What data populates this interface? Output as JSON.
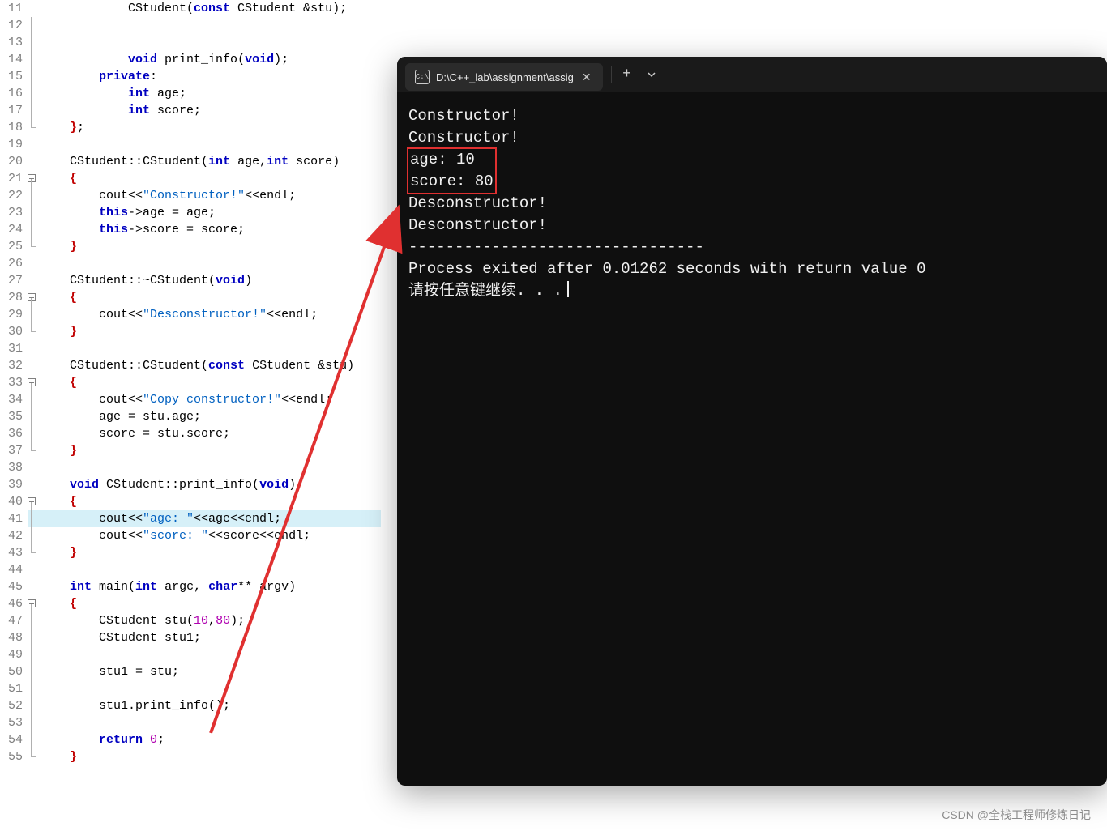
{
  "editor": {
    "lines": [
      {
        "n": 11,
        "fold": " ",
        "html": "        CStudent(<span class='kw'>const</span> CStudent &amp;stu);"
      },
      {
        "n": 12,
        "fold": "|",
        "html": ""
      },
      {
        "n": 13,
        "fold": "|",
        "html": ""
      },
      {
        "n": 14,
        "fold": "|",
        "html": "        <span class='kw'>void</span> print_info(<span class='kw'>void</span>);"
      },
      {
        "n": 15,
        "fold": "|",
        "html": "    <span class='kw'>private</span>:"
      },
      {
        "n": 16,
        "fold": "|",
        "html": "        <span class='kw'>int</span> age;"
      },
      {
        "n": 17,
        "fold": "|",
        "html": "        <span class='kw'>int</span> score;"
      },
      {
        "n": 18,
        "fold": "L",
        "html": "<span class='br'>}</span>;"
      },
      {
        "n": 19,
        "fold": " ",
        "html": ""
      },
      {
        "n": 20,
        "fold": " ",
        "html": "CStudent::CStudent(<span class='kw'>int</span> age,<span class='kw'>int</span> score)"
      },
      {
        "n": 21,
        "fold": "B",
        "html": "<span class='br'>{</span>"
      },
      {
        "n": 22,
        "fold": "|",
        "html": "    cout&lt;&lt;<span class='str'>\"Constructor!\"</span>&lt;&lt;endl;"
      },
      {
        "n": 23,
        "fold": "|",
        "html": "    <span class='kw'>this</span>-&gt;age = age;"
      },
      {
        "n": 24,
        "fold": "|",
        "html": "    <span class='kw'>this</span>-&gt;score = score;"
      },
      {
        "n": 25,
        "fold": "L",
        "html": "<span class='br'>}</span>"
      },
      {
        "n": 26,
        "fold": " ",
        "html": ""
      },
      {
        "n": 27,
        "fold": " ",
        "html": "CStudent::~CStudent(<span class='kw'>void</span>)"
      },
      {
        "n": 28,
        "fold": "B",
        "html": "<span class='br'>{</span>"
      },
      {
        "n": 29,
        "fold": "|",
        "html": "    cout&lt;&lt;<span class='str'>\"Desconstructor!\"</span>&lt;&lt;endl;"
      },
      {
        "n": 30,
        "fold": "L",
        "html": "<span class='br'>}</span>"
      },
      {
        "n": 31,
        "fold": " ",
        "html": ""
      },
      {
        "n": 32,
        "fold": " ",
        "html": "CStudent::CStudent(<span class='kw'>const</span> CStudent &amp;stu)"
      },
      {
        "n": 33,
        "fold": "B",
        "html": "<span class='br'>{</span>"
      },
      {
        "n": 34,
        "fold": "|",
        "html": "    cout&lt;&lt;<span class='str'>\"Copy constructor!\"</span>&lt;&lt;endl;"
      },
      {
        "n": 35,
        "fold": "|",
        "html": "    age = stu.age;"
      },
      {
        "n": 36,
        "fold": "|",
        "html": "    score = stu.score;"
      },
      {
        "n": 37,
        "fold": "L",
        "html": "<span class='br'>}</span>"
      },
      {
        "n": 38,
        "fold": " ",
        "html": ""
      },
      {
        "n": 39,
        "fold": " ",
        "html": "<span class='kw'>void</span> CStudent::print_info(<span class='kw'>void</span>)"
      },
      {
        "n": 40,
        "fold": "B",
        "html": "<span class='br'>{</span>"
      },
      {
        "n": 41,
        "fold": "|",
        "hl": true,
        "html": "    cout&lt;&lt;<span class='str'>\"age: \"</span>&lt;&lt;age&lt;&lt;endl;"
      },
      {
        "n": 42,
        "fold": "|",
        "html": "    cout&lt;&lt;<span class='str'>\"score: \"</span>&lt;&lt;score&lt;&lt;endl;"
      },
      {
        "n": 43,
        "fold": "L",
        "html": "<span class='br'>}</span>"
      },
      {
        "n": 44,
        "fold": " ",
        "html": ""
      },
      {
        "n": 45,
        "fold": " ",
        "html": "<span class='kw'>int</span> main(<span class='kw'>int</span> argc, <span class='kw'>char</span>** argv)"
      },
      {
        "n": 46,
        "fold": "B",
        "html": "<span class='br'>{</span>"
      },
      {
        "n": 47,
        "fold": "|",
        "html": "    CStudent stu(<span class='num'>10</span>,<span class='num'>80</span>);"
      },
      {
        "n": 48,
        "fold": "|",
        "html": "    CStudent stu1;"
      },
      {
        "n": 49,
        "fold": "|",
        "html": ""
      },
      {
        "n": 50,
        "fold": "|",
        "html": "    stu1 = stu;"
      },
      {
        "n": 51,
        "fold": "|",
        "html": ""
      },
      {
        "n": 52,
        "fold": "|",
        "html": "    stu1.print_info();"
      },
      {
        "n": 53,
        "fold": "|",
        "html": ""
      },
      {
        "n": 54,
        "fold": "|",
        "html": "    <span class='kw'>return</span> <span class='num'>0</span>;"
      },
      {
        "n": 55,
        "fold": "L",
        "html": "<span class='br'>}</span>"
      }
    ]
  },
  "terminal": {
    "tab_title": "D:\\C++_lab\\assignment\\assig",
    "lines_before_box": [
      "Constructor!",
      "Constructor!"
    ],
    "box_lines": [
      "age: 10",
      "score: 80"
    ],
    "lines_after_box": [
      "Desconstructor!",
      "Desconstructor!"
    ],
    "divider": "--------------------------------",
    "process_line": "Process exited after 0.01262 seconds with return value 0",
    "prompt_line": "请按任意键继续. . ."
  },
  "watermark": "CSDN @全栈工程师修炼日记"
}
